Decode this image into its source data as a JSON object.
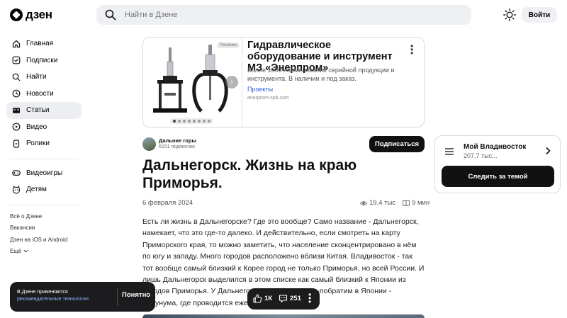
{
  "header": {
    "logo_text": "дзен",
    "search_placeholder": "Найти в Дзене",
    "login_label": "Войти"
  },
  "sidebar": {
    "items": [
      {
        "label": "Главная",
        "icon": "home-icon"
      },
      {
        "label": "Подписки",
        "icon": "check-square-icon"
      },
      {
        "label": "Найти",
        "icon": "search-icon"
      },
      {
        "label": "Новости",
        "icon": "news-icon"
      },
      {
        "label": "Статьи",
        "icon": "article-icon",
        "active": true
      },
      {
        "label": "Видео",
        "icon": "play-icon"
      },
      {
        "label": "Ролики",
        "icon": "shorts-icon"
      }
    ],
    "extra": [
      {
        "label": "Видеоигры",
        "icon": "gamepad-icon"
      },
      {
        "label": "Детям",
        "icon": "kids-icon"
      }
    ],
    "links": [
      "Всё о Дзене",
      "Вакансии",
      "Дзен на iOS и Android",
      "Ещё"
    ]
  },
  "ad": {
    "badge": "Реклама",
    "title": "Гидравлическое оборудование и инструмент МЗ «Энерпром»",
    "description": "Более 1000 наименований серийной продукции и инструмента. В наличии и под заказ.",
    "link": "Проекты",
    "domain": "enerprom-spb.com"
  },
  "article": {
    "channel_name": "Дальние горы",
    "channel_subscribers": "6151 подписчик",
    "subscribe_label": "Подписаться",
    "title": "Дальнегорск. Жизнь на краю Приморья.",
    "date": "6 февраля 2024",
    "views": "19,4 тыс",
    "read_time": "9 мин",
    "body": "Есть ли жизнь в Дальнегорске? Где это вообще? Само название - Дальнегорск, намекает, что это где-то далеко. И действительно, если смотреть на карту Приморского края, то можно заметить, что население сконцентрировано в нём по югу и западу. Много городов расположено вблизи Китая. Владивосток - так тот вообще самый близкий к Корее город не только Приморья, но всей России. И лишь Дальнегорск выделился в этом списке как самый близкий к Японии из городов Приморья. У Дальнегорска имеется город-побратим в Японии - Кацунума, где проводится ежегодный фестиваль"
  },
  "topic": {
    "name": "Мой Владивосток",
    "count": "207,7 тыс...",
    "follow_label": "Следить за темой"
  },
  "cookie": {
    "text": "В Дзене применяются",
    "link": "рекомендательные технологии",
    "accept_label": "Понятно"
  },
  "reactions": {
    "likes": "1К",
    "comments": "251"
  }
}
